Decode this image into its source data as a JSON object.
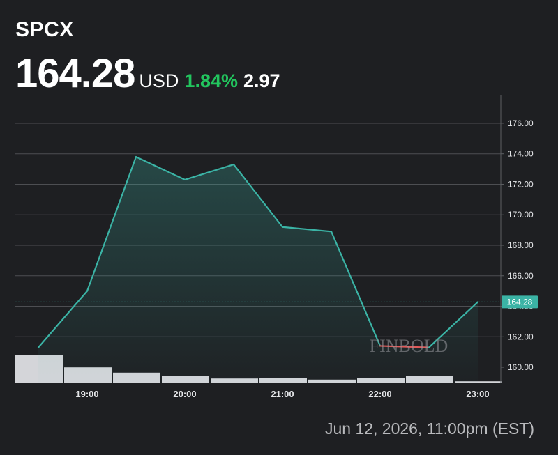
{
  "header": {
    "ticker": "SPCX",
    "price": "164.28",
    "currency": "USD",
    "change_percent": "1.84%",
    "change_absolute": "2.97"
  },
  "colors": {
    "background": "#1e1f22",
    "line": "#3bb3a5",
    "positive": "#22c55e",
    "negative": "#e05a5a",
    "grid": "#5d5f63",
    "volume": "#d4d5d9"
  },
  "watermark": "FINBOLD",
  "timestamp": "Jun 12, 2026, 11:00pm (EST)",
  "chart_data": {
    "type": "line",
    "x": [
      "18:30",
      "19:00",
      "19:30",
      "20:00",
      "20:30",
      "21:00",
      "21:30",
      "22:00",
      "22:30",
      "23:00"
    ],
    "values": [
      161.3,
      165.0,
      173.8,
      172.3,
      173.3,
      169.2,
      168.9,
      161.4,
      161.3,
      164.28
    ],
    "volume_relative": [
      1.0,
      0.57,
      0.38,
      0.27,
      0.17,
      0.19,
      0.13,
      0.2,
      0.27,
      0.07
    ],
    "x_tick_labels": [
      "19:00",
      "20:00",
      "21:00",
      "22:00",
      "23:00"
    ],
    "y_ticks": [
      160,
      162,
      164,
      166,
      168,
      170,
      172,
      174,
      176
    ],
    "y_tick_labels": [
      "160.00",
      "162.00",
      "164.00",
      "166.00",
      "168.00",
      "170.00",
      "172.00",
      "174.00",
      "176.00"
    ],
    "ylim": [
      159.5,
      176.5
    ],
    "last_price_label": "164.28",
    "grid": true,
    "y_axis_position": "right"
  }
}
